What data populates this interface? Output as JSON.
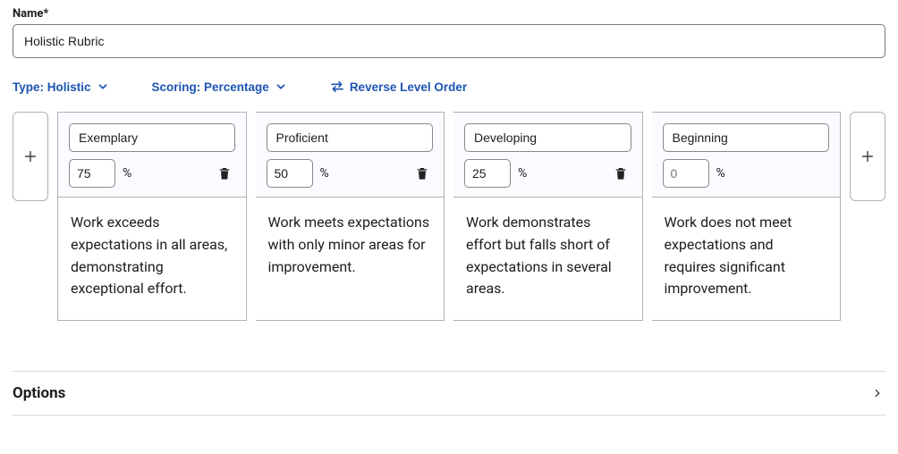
{
  "name_field": {
    "label": "Name*",
    "value": "Holistic Rubric"
  },
  "toolbar": {
    "type_dropdown": "Type: Holistic",
    "scoring_dropdown": "Scoring: Percentage",
    "reverse_button": "Reverse Level Order"
  },
  "score_unit": "%",
  "levels": [
    {
      "name": "Exemplary",
      "score": "75",
      "placeholder": "",
      "description": "Work exceeds expectations in all areas, demonstrating exceptional effort."
    },
    {
      "name": "Proficient",
      "score": "50",
      "placeholder": "",
      "description": "Work meets expectations with only minor areas for improvement."
    },
    {
      "name": "Developing",
      "score": "25",
      "placeholder": "",
      "description": "Work demonstrates effort but falls short of expectations in several areas."
    },
    {
      "name": "Beginning",
      "score": "",
      "placeholder": "0",
      "description": "Work does not meet expectations and requires significant improvement."
    }
  ],
  "options_section": {
    "title": "Options"
  }
}
